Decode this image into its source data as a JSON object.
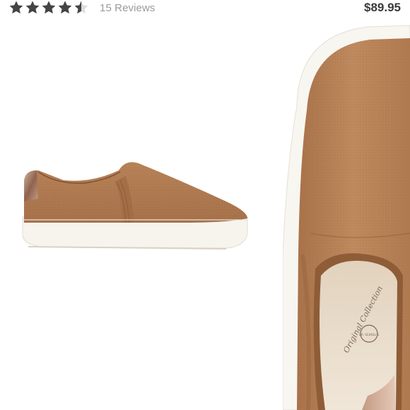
{
  "listing": {
    "reviews_label": "15 Reviews",
    "price": "$89.95",
    "rating": 4.5,
    "rating_max": 5
  },
  "images": {
    "side_view": "slip-on-sneaker-side-view",
    "top_view": "slip-on-sneaker-top-view"
  },
  "insole": {
    "brand_script": "Original Collection",
    "logo_text": "DR. SCHOLL'S"
  },
  "colors": {
    "suede": "#b98459",
    "suede_dark": "#8f5e37",
    "sole": "#f7f4ee",
    "metallic": "#b98a72",
    "star": "#444444",
    "star_empty": "#dcdcdc"
  },
  "icons": {
    "star_full": "star-icon",
    "star_half": "star-half-icon"
  }
}
